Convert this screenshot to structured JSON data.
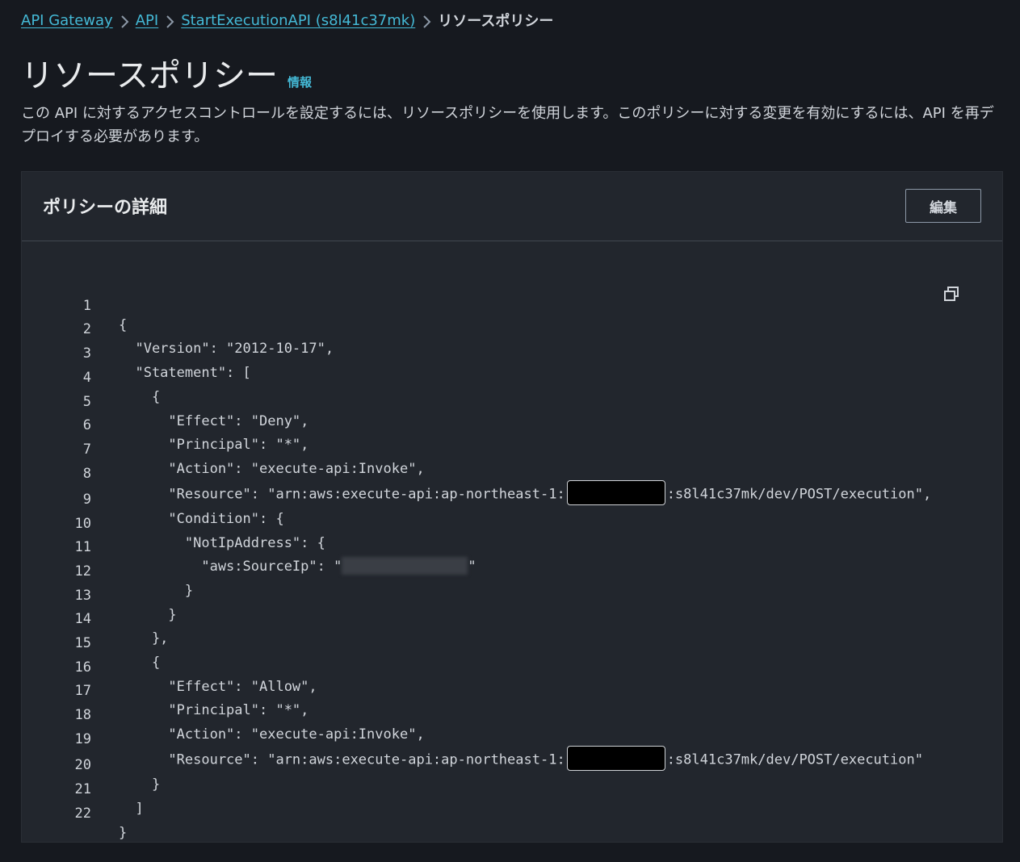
{
  "breadcrumb": {
    "items": [
      "API Gateway",
      "API",
      "StartExecutionAPI (s8l41c37mk)"
    ],
    "current": "リソースポリシー"
  },
  "header": {
    "title": "リソースポリシー",
    "info_label": "情報",
    "description": "この API に対するアクセスコントロールを設定するには、リソースポリシーを使用します。このポリシーに対する変更を有効にするには、API を再デプロイする必要があります。"
  },
  "panel": {
    "title": "ポリシーの詳細",
    "edit_label": "編集",
    "copy_icon": "copy-icon"
  },
  "code": {
    "lines": [
      {
        "no": "1",
        "text": "{"
      },
      {
        "no": "2",
        "text": "  \"Version\": \"2012-10-17\","
      },
      {
        "no": "3",
        "text": "  \"Statement\": ["
      },
      {
        "no": "4",
        "text": "    {"
      },
      {
        "no": "5",
        "text": "      \"Effect\": \"Deny\","
      },
      {
        "no": "6",
        "text": "      \"Principal\": \"*\","
      },
      {
        "no": "7",
        "text": "      \"Action\": \"execute-api:Invoke\","
      },
      {
        "no": "8",
        "pre": "      \"Resource\": \"arn:aws:execute-api:ap-northeast-1:",
        "post": ":s8l41c37mk/dev/POST/execution\","
      },
      {
        "no": "9",
        "text": "      \"Condition\": {"
      },
      {
        "no": "10",
        "text": "        \"NotIpAddress\": {"
      },
      {
        "no": "11",
        "pre": "          \"aws:SourceIp\": \"",
        "post": "\""
      },
      {
        "no": "12",
        "text": "        }"
      },
      {
        "no": "13",
        "text": "      }"
      },
      {
        "no": "14",
        "text": "    },"
      },
      {
        "no": "15",
        "text": "    {"
      },
      {
        "no": "16",
        "text": "      \"Effect\": \"Allow\","
      },
      {
        "no": "17",
        "text": "      \"Principal\": \"*\","
      },
      {
        "no": "18",
        "text": "      \"Action\": \"execute-api:Invoke\","
      },
      {
        "no": "19",
        "pre": "      \"Resource\": \"arn:aws:execute-api:ap-northeast-1:",
        "post": ":s8l41c37mk/dev/POST/execution\""
      },
      {
        "no": "20",
        "text": "    }"
      },
      {
        "no": "21",
        "text": "  ]"
      },
      {
        "no": "22",
        "text": "}"
      }
    ]
  }
}
